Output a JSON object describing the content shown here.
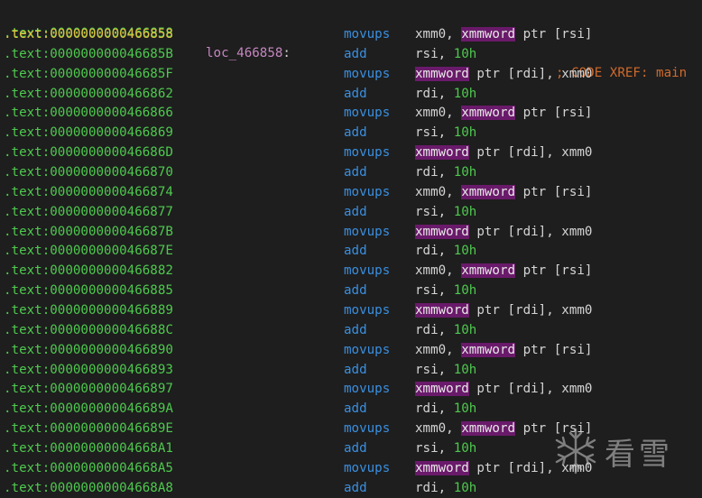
{
  "header": {
    "address": ".text:0000000000466858",
    "label": "loc_466858",
    "colon": ":",
    "xref": "; CODE XREF: main"
  },
  "rows": [
    {
      "addr": ".text:0000000000466858",
      "mnemonic": "movups",
      "op_pre": "xmm0, ",
      "op_hl": "xmmword",
      "op_post": " ptr [rsi]",
      "op_num": ""
    },
    {
      "addr": ".text:000000000046685B",
      "mnemonic": "add",
      "op_pre": "rsi, ",
      "op_hl": "",
      "op_post": "",
      "op_num": "10h"
    },
    {
      "addr": ".text:000000000046685F",
      "mnemonic": "movups",
      "op_pre": "",
      "op_hl": "xmmword",
      "op_post": " ptr [rdi], xmm0",
      "op_num": ""
    },
    {
      "addr": ".text:0000000000466862",
      "mnemonic": "add",
      "op_pre": "rdi, ",
      "op_hl": "",
      "op_post": "",
      "op_num": "10h"
    },
    {
      "addr": ".text:0000000000466866",
      "mnemonic": "movups",
      "op_pre": "xmm0, ",
      "op_hl": "xmmword",
      "op_post": " ptr [rsi]",
      "op_num": ""
    },
    {
      "addr": ".text:0000000000466869",
      "mnemonic": "add",
      "op_pre": "rsi, ",
      "op_hl": "",
      "op_post": "",
      "op_num": "10h"
    },
    {
      "addr": ".text:000000000046686D",
      "mnemonic": "movups",
      "op_pre": "",
      "op_hl": "xmmword",
      "op_post": " ptr [rdi], xmm0",
      "op_num": ""
    },
    {
      "addr": ".text:0000000000466870",
      "mnemonic": "add",
      "op_pre": "rdi, ",
      "op_hl": "",
      "op_post": "",
      "op_num": "10h"
    },
    {
      "addr": ".text:0000000000466874",
      "mnemonic": "movups",
      "op_pre": "xmm0, ",
      "op_hl": "xmmword",
      "op_post": " ptr [rsi]",
      "op_num": ""
    },
    {
      "addr": ".text:0000000000466877",
      "mnemonic": "add",
      "op_pre": "rsi, ",
      "op_hl": "",
      "op_post": "",
      "op_num": "10h"
    },
    {
      "addr": ".text:000000000046687B",
      "mnemonic": "movups",
      "op_pre": "",
      "op_hl": "xmmword",
      "op_post": " ptr [rdi], xmm0",
      "op_num": ""
    },
    {
      "addr": ".text:000000000046687E",
      "mnemonic": "add",
      "op_pre": "rdi, ",
      "op_hl": "",
      "op_post": "",
      "op_num": "10h"
    },
    {
      "addr": ".text:0000000000466882",
      "mnemonic": "movups",
      "op_pre": "xmm0, ",
      "op_hl": "xmmword",
      "op_post": " ptr [rsi]",
      "op_num": ""
    },
    {
      "addr": ".text:0000000000466885",
      "mnemonic": "add",
      "op_pre": "rsi, ",
      "op_hl": "",
      "op_post": "",
      "op_num": "10h"
    },
    {
      "addr": ".text:0000000000466889",
      "mnemonic": "movups",
      "op_pre": "",
      "op_hl": "xmmword",
      "op_post": " ptr [rdi], xmm0",
      "op_num": ""
    },
    {
      "addr": ".text:000000000046688C",
      "mnemonic": "add",
      "op_pre": "rdi, ",
      "op_hl": "",
      "op_post": "",
      "op_num": "10h"
    },
    {
      "addr": ".text:0000000000466890",
      "mnemonic": "movups",
      "op_pre": "xmm0, ",
      "op_hl": "xmmword",
      "op_post": " ptr [rsi]",
      "op_num": ""
    },
    {
      "addr": ".text:0000000000466893",
      "mnemonic": "add",
      "op_pre": "rsi, ",
      "op_hl": "",
      "op_post": "",
      "op_num": "10h"
    },
    {
      "addr": ".text:0000000000466897",
      "mnemonic": "movups",
      "op_pre": "",
      "op_hl": "xmmword",
      "op_post": " ptr [rdi], xmm0",
      "op_num": ""
    },
    {
      "addr": ".text:000000000046689A",
      "mnemonic": "add",
      "op_pre": "rdi, ",
      "op_hl": "",
      "op_post": "",
      "op_num": "10h"
    },
    {
      "addr": ".text:000000000046689E",
      "mnemonic": "movups",
      "op_pre": "xmm0, ",
      "op_hl": "xmmword",
      "op_post": " ptr [rsi]",
      "op_num": ""
    },
    {
      "addr": ".text:00000000004668A1",
      "mnemonic": "add",
      "op_pre": "rsi, ",
      "op_hl": "",
      "op_post": "",
      "op_num": "10h"
    },
    {
      "addr": ".text:00000000004668A5",
      "mnemonic": "movups",
      "op_pre": "",
      "op_hl": "xmmword",
      "op_post": " ptr [rdi], xmm0",
      "op_num": ""
    },
    {
      "addr": ".text:00000000004668A8",
      "mnemonic": "add",
      "op_pre": "rdi, ",
      "op_hl": "",
      "op_post": "",
      "op_num": "10h"
    }
  ],
  "watermark": {
    "text": "看雪",
    "icon": "snowflake-icon"
  },
  "colors": {
    "background": "#1e1e1e",
    "address": "#4ec94e",
    "current_address": "#e0c040",
    "label": "#c586c0",
    "xref_comment": "#d06a2c",
    "mnemonic": "#3a8fe0",
    "operand": "#d4d4d4",
    "highlight_bg": "#6a1a6a"
  }
}
